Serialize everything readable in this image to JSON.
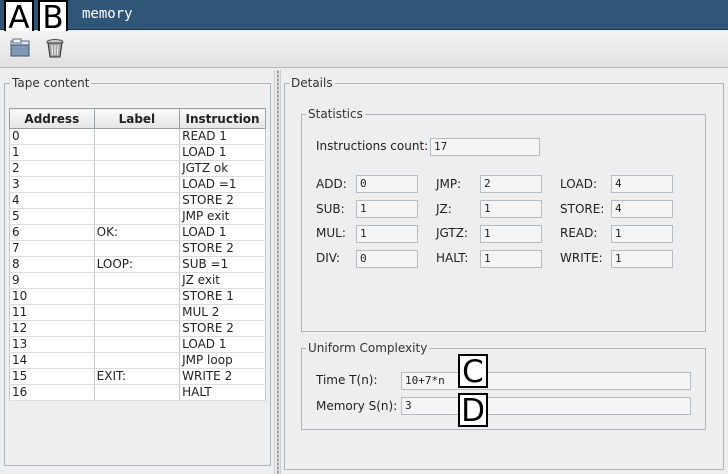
{
  "window": {
    "title": "memory"
  },
  "markers": {
    "a": "A",
    "b": "B",
    "c": "C",
    "d": "D"
  },
  "toolbar": {
    "open_icon": "folder-icon",
    "delete_icon": "trash-icon"
  },
  "tape": {
    "legend": "Tape content",
    "columns": [
      "Address",
      "Label",
      "Instruction"
    ],
    "rows": [
      [
        "0",
        "",
        "READ 1"
      ],
      [
        "1",
        "",
        "LOAD 1"
      ],
      [
        "2",
        "",
        "JGTZ ok"
      ],
      [
        "3",
        "",
        "LOAD =1"
      ],
      [
        "4",
        "",
        "STORE 2"
      ],
      [
        "5",
        "",
        "JMP exit"
      ],
      [
        "6",
        "OK:",
        "LOAD 1"
      ],
      [
        "7",
        "",
        "STORE 2"
      ],
      [
        "8",
        "LOOP:",
        "SUB =1"
      ],
      [
        "9",
        "",
        "JZ exit"
      ],
      [
        "10",
        "",
        "STORE 1"
      ],
      [
        "11",
        "",
        "MUL 2"
      ],
      [
        "12",
        "",
        "STORE 2"
      ],
      [
        "13",
        "",
        "LOAD 1"
      ],
      [
        "14",
        "",
        "JMP loop"
      ],
      [
        "15",
        "EXIT:",
        "WRITE 2"
      ],
      [
        "16",
        "",
        "HALT"
      ]
    ]
  },
  "details": {
    "legend": "Details",
    "statistics": {
      "legend": "Statistics",
      "instructions_count_label": "Instructions count:",
      "instructions_count": "17",
      "add_label": "ADD:",
      "add": "0",
      "sub_label": "SUB:",
      "sub": "1",
      "mul_label": "MUL:",
      "mul": "1",
      "div_label": "DIV:",
      "div": "0",
      "jmp_label": "JMP:",
      "jmp": "2",
      "jz_label": "JZ:",
      "jz": "1",
      "jgtz_label": "JGTZ:",
      "jgtz": "1",
      "halt_label": "HALT:",
      "halt": "1",
      "load_label": "LOAD:",
      "load": "4",
      "store_label": "STORE:",
      "store": "4",
      "read_label": "READ:",
      "read": "1",
      "write_label": "WRITE:",
      "write": "1"
    },
    "complexity": {
      "legend": "Uniform Complexity",
      "time_label": "Time T(n):",
      "time": "10+7*n",
      "memory_label": "Memory S(n):",
      "memory": "3"
    }
  }
}
